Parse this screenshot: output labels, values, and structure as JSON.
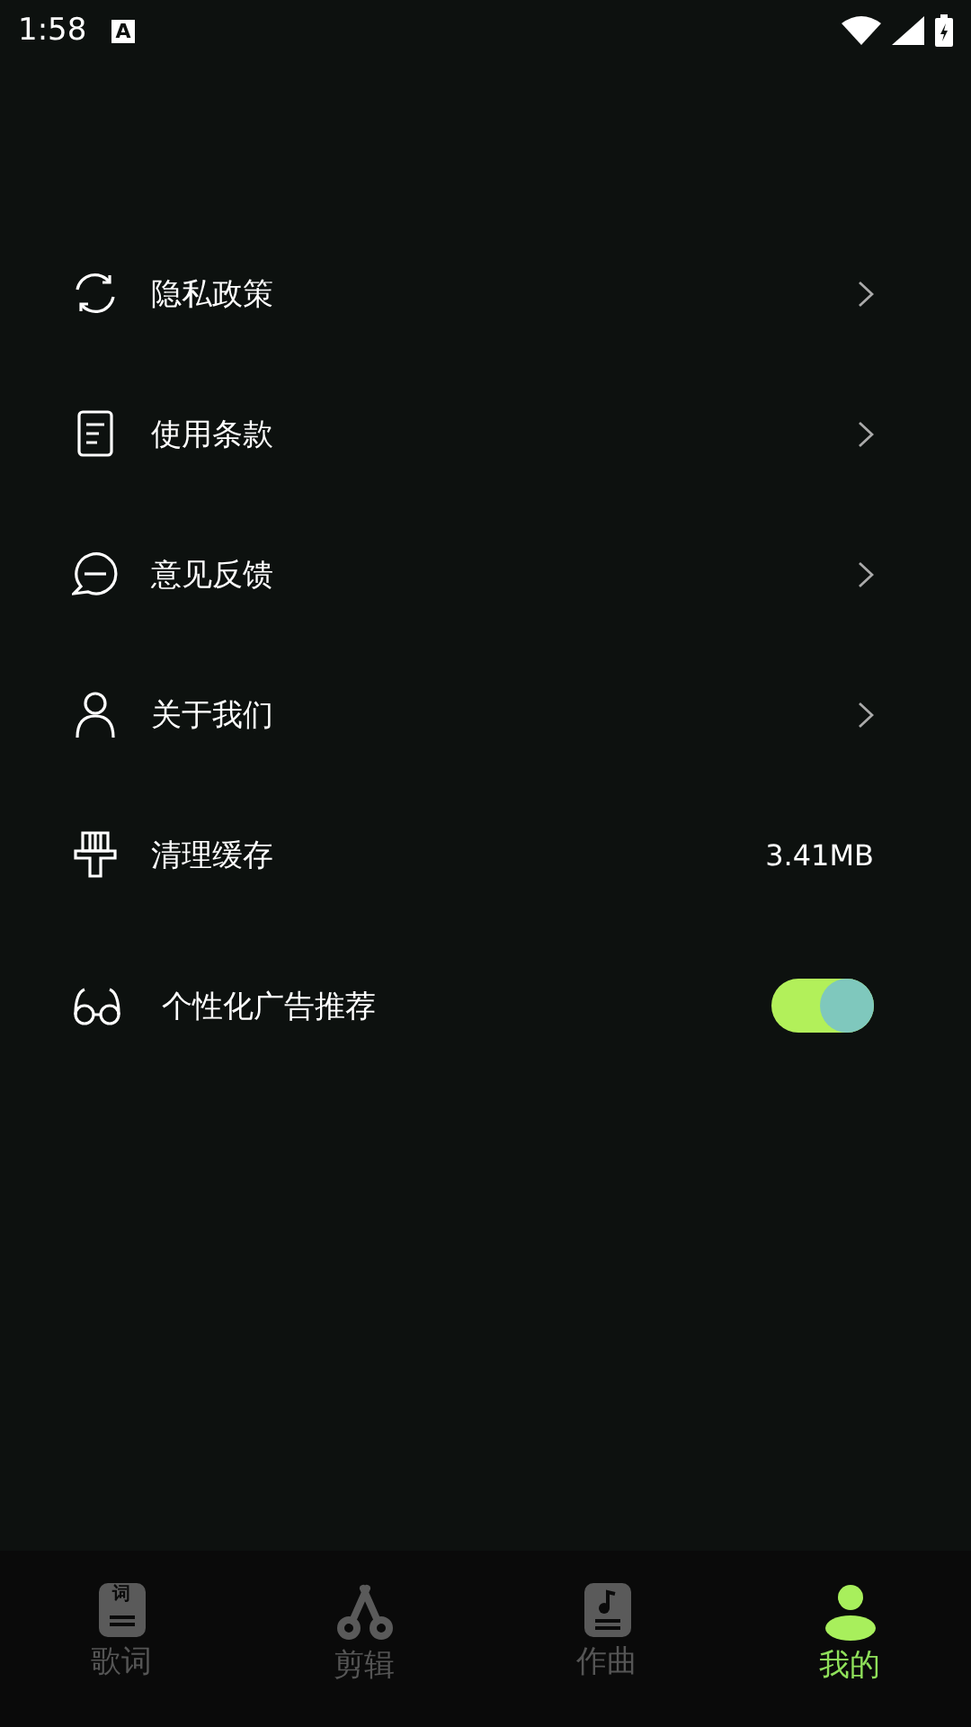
{
  "status_bar": {
    "time": "1:58",
    "notification": "A"
  },
  "menu": [
    {
      "kind": "link",
      "label": "隐私政策"
    },
    {
      "kind": "link",
      "label": "使用条款"
    },
    {
      "kind": "link",
      "label": "意见反馈"
    },
    {
      "kind": "link",
      "label": "关于我们"
    },
    {
      "kind": "value",
      "label": "清理缓存",
      "value": "3.41MB"
    },
    {
      "kind": "toggle",
      "label": "个性化广告推荐",
      "on": true
    }
  ],
  "bottom_nav": [
    {
      "label": "歌词",
      "icon_text": "词",
      "selected": false
    },
    {
      "label": "剪辑",
      "selected": false
    },
    {
      "label": "作曲",
      "selected": false
    },
    {
      "label": "我的",
      "selected": true
    }
  ]
}
